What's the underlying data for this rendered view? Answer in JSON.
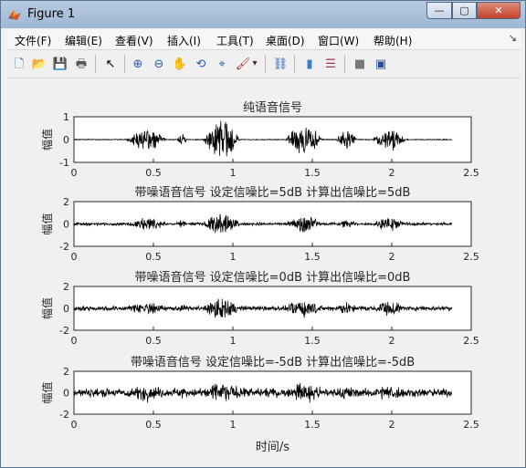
{
  "window": {
    "title": "Figure 1",
    "buttons": {
      "minimize": "—",
      "maximize": "▢",
      "close": "✕"
    }
  },
  "menubar": {
    "items": [
      "文件(F)",
      "编辑(E)",
      "查看(V)",
      "插入(I)",
      "工具(T)",
      "桌面(D)",
      "窗口(W)",
      "帮助(H)"
    ],
    "dock_arrow": "↘"
  },
  "toolbar": {
    "tools": [
      {
        "icon": "new-figure-icon",
        "glyph": "🗋"
      },
      {
        "icon": "open-file-icon",
        "glyph": "📂"
      },
      {
        "icon": "save-icon",
        "glyph": "💾"
      },
      {
        "icon": "print-icon",
        "glyph": "🖶"
      },
      {
        "icon": "pointer-icon",
        "glyph": "↖"
      },
      {
        "icon": "zoom-in-icon",
        "glyph": "⊕"
      },
      {
        "icon": "zoom-out-icon",
        "glyph": "⊖"
      },
      {
        "icon": "pan-icon",
        "glyph": "✋"
      },
      {
        "icon": "rotate-3d-icon",
        "glyph": "⟲"
      },
      {
        "icon": "data-cursor-icon",
        "glyph": "⌖"
      },
      {
        "icon": "brush-icon",
        "glyph": "🖌"
      },
      {
        "icon": "brush-dropdown-icon",
        "glyph": "▾"
      },
      {
        "icon": "link-plot-icon",
        "glyph": "⛓"
      },
      {
        "icon": "colorbar-icon",
        "glyph": "▮"
      },
      {
        "icon": "legend-icon",
        "glyph": "☰"
      },
      {
        "icon": "hide-plot-tools-icon",
        "glyph": "■"
      },
      {
        "icon": "show-plot-tools-icon",
        "glyph": "▣"
      }
    ]
  },
  "figure": {
    "xlabel": "时间/s",
    "ylabel": "幅值",
    "xticks": [
      "0",
      "0.5",
      "1",
      "1.5",
      "2",
      "2.5"
    ],
    "subplots": [
      {
        "title": "纯语音信号",
        "yticks": [
          "1",
          "0",
          "-1"
        ]
      },
      {
        "title": "带噪语音信号 设定信噪比=5dB  计算出信噪比=5dB",
        "yticks": [
          "2",
          "0",
          "-2"
        ]
      },
      {
        "title": "带噪语音信号 设定信噪比=0dB  计算出信噪比=0dB",
        "yticks": [
          "2",
          "0",
          "-2"
        ]
      },
      {
        "title": "带噪语音信号 设定信噪比=-5dB  计算出信噪比=-5dB",
        "yticks": [
          "2",
          "0",
          "-2"
        ]
      }
    ]
  },
  "chart_data": [
    {
      "type": "line",
      "title": "纯语音信号",
      "xlabel": "",
      "ylabel": "幅值",
      "xlim": [
        0,
        2.5
      ],
      "ylim": [
        -1,
        1
      ],
      "signal_duration": 2.38,
      "note_envelope": "speech bursts"
    },
    {
      "type": "line",
      "title": "带噪语音信号 设定信噪比=5dB  计算出信噪比=5dB",
      "xlabel": "",
      "ylabel": "幅值",
      "xlim": [
        0,
        2.5
      ],
      "ylim": [
        -2,
        2
      ],
      "signal_duration": 2.38,
      "snr_db": 5
    },
    {
      "type": "line",
      "title": "带噪语音信号 设定信噪比=0dB  计算出信噪比=0dB",
      "xlabel": "",
      "ylabel": "幅值",
      "xlim": [
        0,
        2.5
      ],
      "ylim": [
        -2,
        2
      ],
      "signal_duration": 2.38,
      "snr_db": 0
    },
    {
      "type": "line",
      "title": "带噪语音信号 设定信噪比=-5dB  计算出信噪比=-5dB",
      "xlabel": "时间/s",
      "ylabel": "幅值",
      "xlim": [
        0,
        2.5
      ],
      "ylim": [
        -2,
        2
      ],
      "signal_duration": 2.38,
      "snr_db": -5
    }
  ]
}
